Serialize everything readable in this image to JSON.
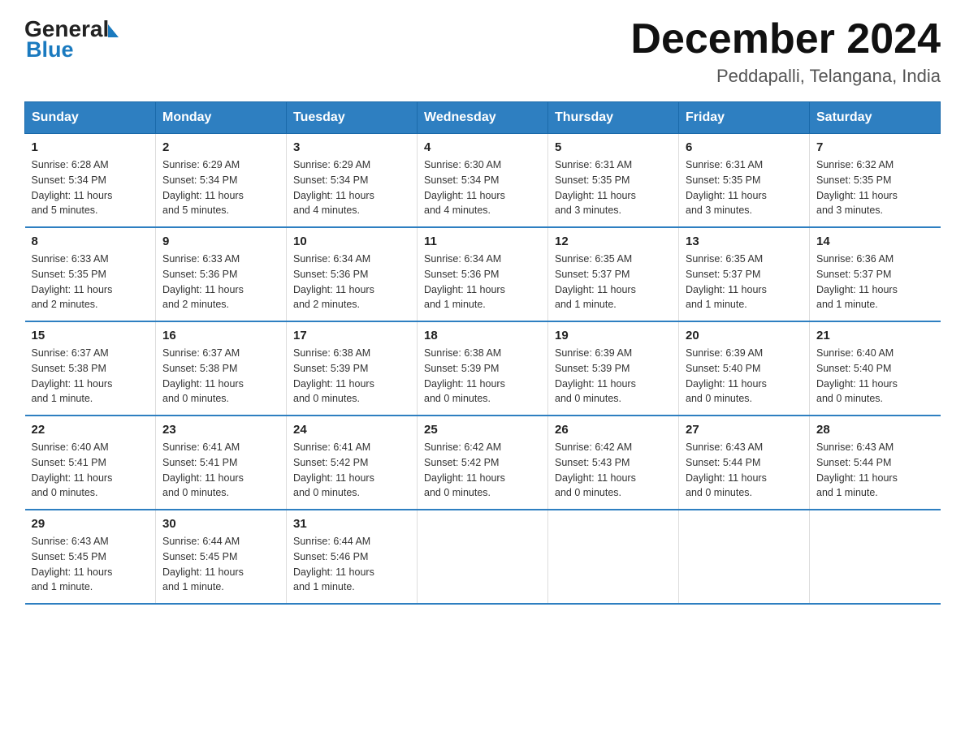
{
  "header": {
    "logo_general": "General",
    "logo_blue": "Blue",
    "month_title": "December 2024",
    "location": "Peddapalli, Telangana, India"
  },
  "days_of_week": [
    "Sunday",
    "Monday",
    "Tuesday",
    "Wednesday",
    "Thursday",
    "Friday",
    "Saturday"
  ],
  "weeks": [
    [
      {
        "day": "1",
        "sunrise": "6:28 AM",
        "sunset": "5:34 PM",
        "daylight": "11 hours and 5 minutes."
      },
      {
        "day": "2",
        "sunrise": "6:29 AM",
        "sunset": "5:34 PM",
        "daylight": "11 hours and 5 minutes."
      },
      {
        "day": "3",
        "sunrise": "6:29 AM",
        "sunset": "5:34 PM",
        "daylight": "11 hours and 4 minutes."
      },
      {
        "day": "4",
        "sunrise": "6:30 AM",
        "sunset": "5:34 PM",
        "daylight": "11 hours and 4 minutes."
      },
      {
        "day": "5",
        "sunrise": "6:31 AM",
        "sunset": "5:35 PM",
        "daylight": "11 hours and 3 minutes."
      },
      {
        "day": "6",
        "sunrise": "6:31 AM",
        "sunset": "5:35 PM",
        "daylight": "11 hours and 3 minutes."
      },
      {
        "day": "7",
        "sunrise": "6:32 AM",
        "sunset": "5:35 PM",
        "daylight": "11 hours and 3 minutes."
      }
    ],
    [
      {
        "day": "8",
        "sunrise": "6:33 AM",
        "sunset": "5:35 PM",
        "daylight": "11 hours and 2 minutes."
      },
      {
        "day": "9",
        "sunrise": "6:33 AM",
        "sunset": "5:36 PM",
        "daylight": "11 hours and 2 minutes."
      },
      {
        "day": "10",
        "sunrise": "6:34 AM",
        "sunset": "5:36 PM",
        "daylight": "11 hours and 2 minutes."
      },
      {
        "day": "11",
        "sunrise": "6:34 AM",
        "sunset": "5:36 PM",
        "daylight": "11 hours and 1 minute."
      },
      {
        "day": "12",
        "sunrise": "6:35 AM",
        "sunset": "5:37 PM",
        "daylight": "11 hours and 1 minute."
      },
      {
        "day": "13",
        "sunrise": "6:35 AM",
        "sunset": "5:37 PM",
        "daylight": "11 hours and 1 minute."
      },
      {
        "day": "14",
        "sunrise": "6:36 AM",
        "sunset": "5:37 PM",
        "daylight": "11 hours and 1 minute."
      }
    ],
    [
      {
        "day": "15",
        "sunrise": "6:37 AM",
        "sunset": "5:38 PM",
        "daylight": "11 hours and 1 minute."
      },
      {
        "day": "16",
        "sunrise": "6:37 AM",
        "sunset": "5:38 PM",
        "daylight": "11 hours and 0 minutes."
      },
      {
        "day": "17",
        "sunrise": "6:38 AM",
        "sunset": "5:39 PM",
        "daylight": "11 hours and 0 minutes."
      },
      {
        "day": "18",
        "sunrise": "6:38 AM",
        "sunset": "5:39 PM",
        "daylight": "11 hours and 0 minutes."
      },
      {
        "day": "19",
        "sunrise": "6:39 AM",
        "sunset": "5:39 PM",
        "daylight": "11 hours and 0 minutes."
      },
      {
        "day": "20",
        "sunrise": "6:39 AM",
        "sunset": "5:40 PM",
        "daylight": "11 hours and 0 minutes."
      },
      {
        "day": "21",
        "sunrise": "6:40 AM",
        "sunset": "5:40 PM",
        "daylight": "11 hours and 0 minutes."
      }
    ],
    [
      {
        "day": "22",
        "sunrise": "6:40 AM",
        "sunset": "5:41 PM",
        "daylight": "11 hours and 0 minutes."
      },
      {
        "day": "23",
        "sunrise": "6:41 AM",
        "sunset": "5:41 PM",
        "daylight": "11 hours and 0 minutes."
      },
      {
        "day": "24",
        "sunrise": "6:41 AM",
        "sunset": "5:42 PM",
        "daylight": "11 hours and 0 minutes."
      },
      {
        "day": "25",
        "sunrise": "6:42 AM",
        "sunset": "5:42 PM",
        "daylight": "11 hours and 0 minutes."
      },
      {
        "day": "26",
        "sunrise": "6:42 AM",
        "sunset": "5:43 PM",
        "daylight": "11 hours and 0 minutes."
      },
      {
        "day": "27",
        "sunrise": "6:43 AM",
        "sunset": "5:44 PM",
        "daylight": "11 hours and 0 minutes."
      },
      {
        "day": "28",
        "sunrise": "6:43 AM",
        "sunset": "5:44 PM",
        "daylight": "11 hours and 1 minute."
      }
    ],
    [
      {
        "day": "29",
        "sunrise": "6:43 AM",
        "sunset": "5:45 PM",
        "daylight": "11 hours and 1 minute."
      },
      {
        "day": "30",
        "sunrise": "6:44 AM",
        "sunset": "5:45 PM",
        "daylight": "11 hours and 1 minute."
      },
      {
        "day": "31",
        "sunrise": "6:44 AM",
        "sunset": "5:46 PM",
        "daylight": "11 hours and 1 minute."
      },
      null,
      null,
      null,
      null
    ]
  ],
  "labels": {
    "sunrise": "Sunrise:",
    "sunset": "Sunset:",
    "daylight": "Daylight:"
  }
}
